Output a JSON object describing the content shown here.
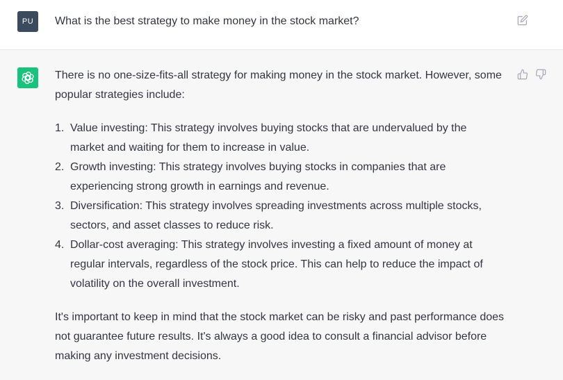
{
  "user": {
    "avatar_initials": "PU",
    "question": "What is the best strategy to make money in the stock market?"
  },
  "assistant": {
    "intro": "There is no one-size-fits-all strategy for making money in the stock market. However, some popular strategies include:",
    "items": [
      {
        "number": "1.",
        "text": "Value investing: This strategy involves buying stocks that are undervalued by the market and waiting for them to increase in value."
      },
      {
        "number": "2.",
        "text": "Growth investing: This strategy involves buying stocks in companies that are experiencing strong growth in earnings and revenue."
      },
      {
        "number": "3.",
        "text": "Diversification: This strategy involves spreading investments across multiple stocks, sectors, and asset classes to reduce risk."
      },
      {
        "number": "4.",
        "text": "Dollar-cost averaging: This strategy involves investing a fixed amount of money at regular intervals, regardless of the stock price. This can help to reduce the impact of volatility on the overall investment."
      }
    ],
    "conclusion": "It's important to keep in mind that the stock market can be risky and past performance does not guarantee future results. It's always a good idea to consult a financial advisor before making any investment decisions."
  },
  "icons": {
    "edit": "edit-icon",
    "thumbs_up": "thumbs-up-icon",
    "thumbs_down": "thumbs-down-icon",
    "assistant_logo": "openai-logo-icon"
  },
  "colors": {
    "assistant_avatar": "#19c37d",
    "user_avatar": "#3c4a5e",
    "text": "#343541",
    "assistant_bg": "#f7f7f8"
  }
}
